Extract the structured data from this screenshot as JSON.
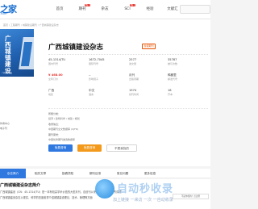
{
  "header": {
    "logo_mark": "之家",
    "logo_sub": ".COM",
    "nav": [
      {
        "label": "首页",
        "badge": ""
      },
      {
        "label": "期刊",
        "badge": "热门"
      },
      {
        "label": "杂志",
        "badge": ""
      },
      {
        "label": "SCI",
        "badge": "热门"
      },
      {
        "label": "经验",
        "badge": ""
      },
      {
        "label": "文献汇",
        "badge": ""
      }
    ]
  },
  "breadcrumb": "首页 / 工程期刊 / 城镇建设期刊 / 广西城镇建设杂志",
  "cover": {
    "title": "广西城镇建设",
    "foot": "广西城镇建设"
  },
  "journal": {
    "title": "广西城镇建设杂志",
    "tag": "省级期刊",
    "fields": [
      {
        "value": "45-1314/TU",
        "label": "国内刊号"
      },
      {
        "value": "1672-7045",
        "label": "国际刊号"
      },
      {
        "value": "2577",
        "label": "发文量"
      },
      {
        "value": "35787",
        "label": "被引次数"
      },
      {
        "value": "¥ 468.00",
        "label": "全年订价"
      },
      {
        "value": "--",
        "label": "影响因子"
      },
      {
        "value": "月刊",
        "label": "出版周期"
      },
      {
        "value": "鸭都里",
        "label": "邮发代号"
      },
      {
        "value": "广西",
        "label": "地区"
      },
      {
        "value": "中文",
        "label": "语言"
      },
      {
        "value": "1974",
        "label": "创刊时间"
      },
      {
        "value": "16",
        "label": "开本"
      }
    ],
    "info_label": "所属分类：",
    "info_text": "经济 / 建筑科学 / 城建 / 规划",
    "collect_label": "收录信息：",
    "collect_text": "中国期刊全文数据库 (CJFD)",
    "honor_label": "期刊荣誉：",
    "honor_text": "中国优秀期刊遴选数据库"
  },
  "buttons": {
    "submit": "免费咨询",
    "subscribe": "免费咨询",
    "other": "不是我找的"
  },
  "left_notes": [
    "作者中心",
    "电子刊"
  ],
  "tabs": [
    "杂志简介",
    "相关文章",
    "投稿须知",
    "期刊目录",
    "常见问题",
    "更多信息"
  ],
  "content": {
    "heading": "广西城镇建设杂志简介",
    "para1": "广西城镇建设（CN：45-1314/TU）是一本有较高学术价值的大型月刊，自创刊以来，选题新颖而不失厚重",
    "para2": "广西城镇建设杂志以现实、科学的态度着重介绍城镇建设理论、技术、管理等方面"
  },
  "watermark": {
    "main": "自动秒收录",
    "sub": "加上链接 一来访 一次 一自动收录"
  },
  "side_box": "不是你找的？点这里"
}
